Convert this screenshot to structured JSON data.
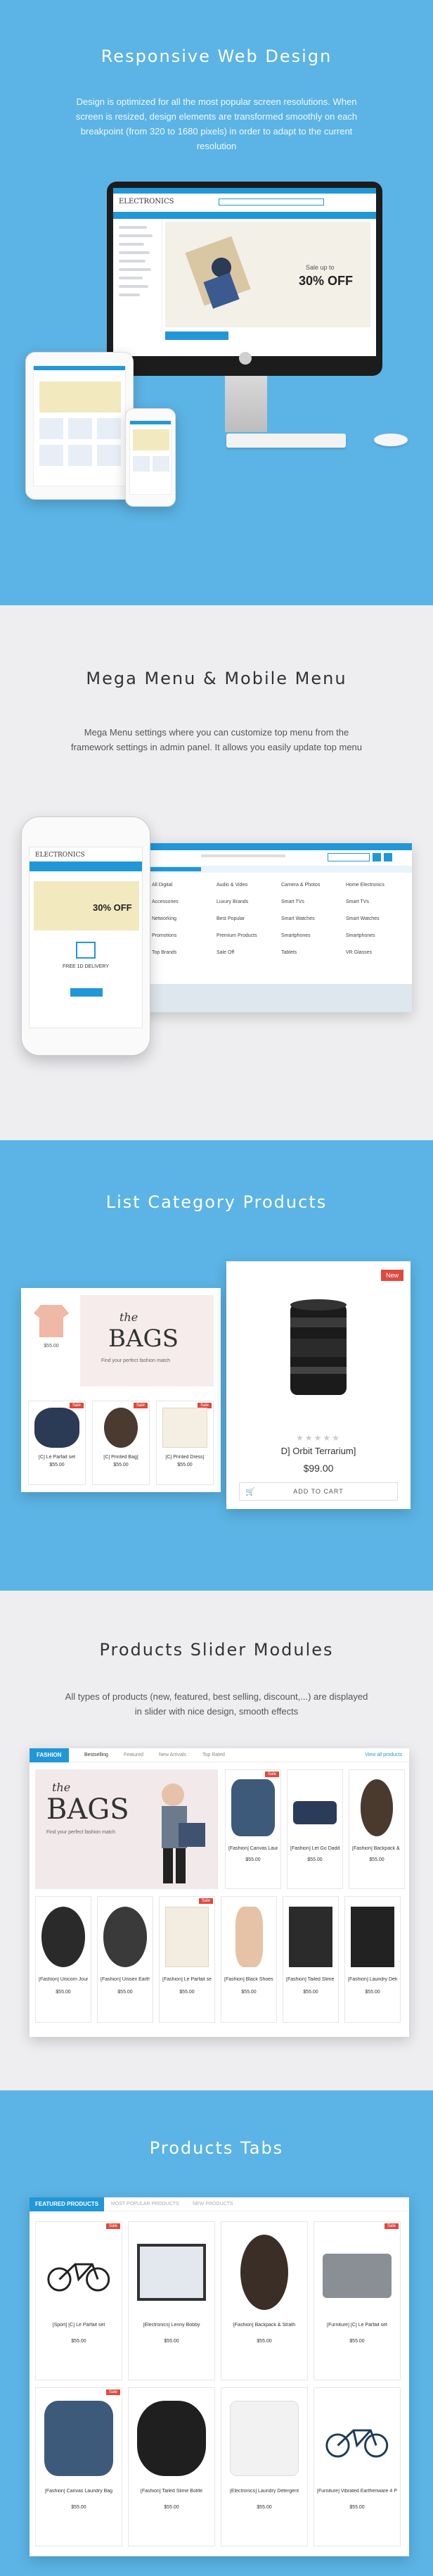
{
  "sections": {
    "responsive": {
      "title": "Responsive Web Design",
      "desc": "Design is optimized for all the most popular screen resolutions. When screen is resized, design elements are transformed smoothly on each breakpoint (from 320 to 1680 pixels) in order to adapt to the current resolution",
      "store_logo": "ELECTRONICS",
      "promo_small": "Sale up to",
      "promo_big": "30% OFF"
    },
    "megamenu": {
      "title": "Mega Menu & Mobile Menu",
      "desc": "Mega Menu settings where you can customize top menu from the framework settings in admin panel. It allows you easily update top menu",
      "phone_logo": "ELECTRONICS",
      "phone_promo": "30% OFF",
      "phone_free": "FREE 1D DELIVERY",
      "menu_cols": [
        [
          "All Digital",
          "Accessories",
          "Networking",
          "Promotions",
          "Top Brands"
        ],
        [
          "Audio & Video",
          "Luxury Brands",
          "Best Popular",
          "Premium Products",
          "Sale Off"
        ],
        [
          "Camera & Photos",
          "Smart TVs",
          "Smart Watches",
          "Smartphones",
          "Tablets"
        ],
        [
          "Home Electronics",
          "Smart TVs",
          "Smart Watches",
          "Smartphones",
          "VR Glasses"
        ]
      ]
    },
    "listcat": {
      "title": "List Category Products",
      "banner_the": "the",
      "banner_bags": "BAGS",
      "banner_sub": "Find your perfect fashion match",
      "badge": "New",
      "product_name": "D] Orbit Terrarium]",
      "product_price": "$99.00",
      "add_to_cart": "ADD TO CART",
      "left_price": "$55.00",
      "left_items": [
        {
          "name": "[C] Le Parfait set",
          "price": "$55.00"
        },
        {
          "name": "[C] Printed Bag]",
          "price": "$55.00"
        },
        {
          "name": "[C] Printed Dress]",
          "price": "$55.00"
        }
      ]
    },
    "slider": {
      "title": "Products Slider Modules",
      "desc": "All types of products (new, featured, best selling, discount,...) are displayed in slider with nice design, smooth effects",
      "tabs": [
        "FASHION",
        "Bestselling",
        "Featured",
        "New Arrivals",
        "Top Rated"
      ],
      "view_all": "View all products",
      "banner_the": "the",
      "banner_bags": "BAGS",
      "banner_sub": "Find your perfect fashion match",
      "row1": [
        {
          "name": "[Fashion] Canvas Laundry Bag",
          "price": "$55.00"
        },
        {
          "name": "[Fashion] Let Go Daddy",
          "price": "$55.00"
        },
        {
          "name": "[Fashion] Backpack & Strath",
          "price": "$55.00"
        }
      ],
      "row2": [
        {
          "name": "[Fashion] Unicorn Journal 1.0",
          "price": "$55.00"
        },
        {
          "name": "[Fashion] Unisex Earthenware 4 Pcs",
          "price": "$55.00"
        },
        {
          "name": "[Fashion] Le Parfait set",
          "price": "$55.00"
        },
        {
          "name": "[Fashion] Black Shoes in Boss",
          "price": "$55.00"
        },
        {
          "name": "[Fashion] Tailed Slime Bottle",
          "price": "$55.00"
        },
        {
          "name": "[Fashion] Laundry Detergent",
          "price": "$55.00"
        }
      ]
    },
    "tabs": {
      "title": "Products Tabs",
      "tabs": [
        "FEATURED PRODUCTS",
        "MOST POPULAR PRODUCTS",
        "NEW PRODUCTS"
      ],
      "row1": [
        {
          "name": "[Sport] [C] Le Parfait set",
          "price": "$55.00"
        },
        {
          "name": "[Electronics] Lenny Bobby",
          "price": "$55.00"
        },
        {
          "name": "[Fashion] Backpack & Strath",
          "price": "$55.00"
        },
        {
          "name": "[Furniture] [C] Le Parfait set",
          "price": "$55.00"
        }
      ],
      "row2": [
        {
          "name": "[Fashion] Canvas Laundry Bag",
          "price": "$55.00"
        },
        {
          "name": "[Fashion] Tailed Slime Bottle",
          "price": "$55.00"
        },
        {
          "name": "[Electronics] Laundry Detergent",
          "price": "$55.00"
        },
        {
          "name": "[Furniture] Vibrated Earthenware 4 Pcs",
          "price": "$55.00"
        }
      ]
    }
  },
  "colors": {
    "blue": "#5bb4e5",
    "gray": "#eeeef1",
    "accent": "#2197d8",
    "sale": "#e0493e"
  }
}
